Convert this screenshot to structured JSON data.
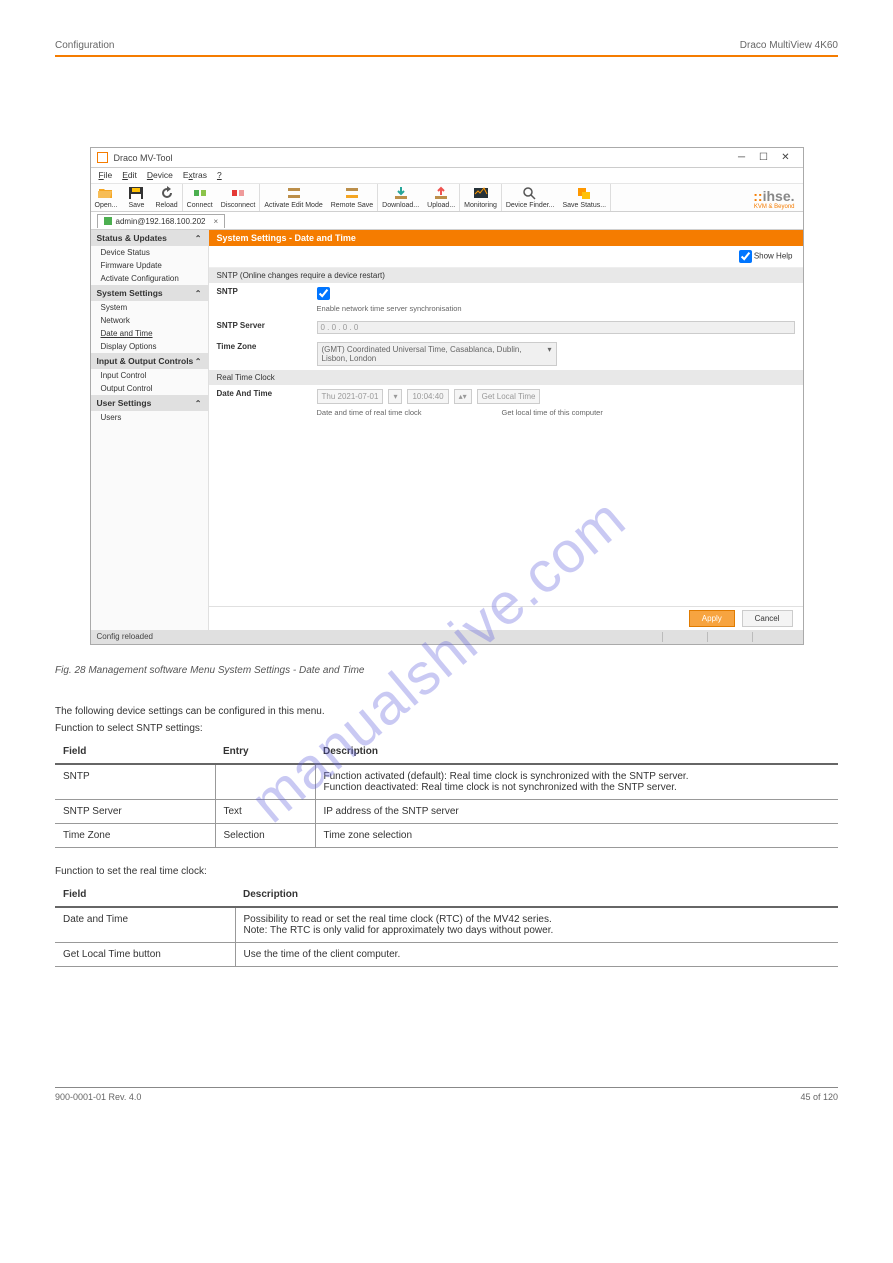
{
  "header": {
    "left": "Configuration",
    "right": "Draco MultiView 4K60"
  },
  "app": {
    "title": "Draco MV-Tool",
    "menus": [
      "File",
      "Edit",
      "Device",
      "Extras",
      "?"
    ],
    "toolbar": {
      "open": "Open...",
      "save": "Save",
      "reload": "Reload",
      "connect": "Connect",
      "disconnect": "Disconnect",
      "activate_edit_mode": "Activate Edit Mode",
      "remote_save": "Remote Save",
      "download": "Download...",
      "upload": "Upload...",
      "monitoring": "Monitoring",
      "device_finder": "Device Finder...",
      "save_status": "Save Status..."
    },
    "logo": "ihse.",
    "logo_sub": "KVM & Beyond",
    "tab": {
      "label": "admin@192.168.100.202"
    },
    "sidebar": {
      "sections": [
        {
          "title": "Status & Updates",
          "items": [
            "Device Status",
            "Firmware Update",
            "Activate Configuration"
          ]
        },
        {
          "title": "System Settings",
          "items": [
            "System",
            "Network",
            "Date and Time",
            "Display Options"
          ],
          "active_index": 2
        },
        {
          "title": "Input & Output Controls",
          "items": [
            "Input Control",
            "Output Control"
          ]
        },
        {
          "title": "User Settings",
          "items": [
            "Users"
          ]
        }
      ]
    },
    "content": {
      "title": "System Settings - Date and Time",
      "show_help": "Show Help",
      "sntp_section": "SNTP (Online changes require a device restart)",
      "sntp_label": "SNTP",
      "sntp_hint": "Enable network time server synchronisation",
      "sntp_server_label": "SNTP Server",
      "sntp_server_val": "0  .  0  .  0  .  0",
      "timezone_label": "Time Zone",
      "timezone_val": "(GMT) Coordinated Universal Time, Casablanca, Dublin, Lisbon, London",
      "rtc_section": "Real Time Clock",
      "datetime_label": "Date And Time",
      "date_val": "Thu    2021-07-01",
      "time_val": "10:04:40",
      "datetime_btn": "Get Local Time",
      "datetime_hint1": "Date and time of real time clock",
      "datetime_hint2": "Get local time of this computer"
    },
    "buttons": {
      "apply": "Apply",
      "cancel": "Cancel"
    },
    "status": "Config reloaded"
  },
  "watermark": "manualshive.com",
  "caption": "Fig. 28 Management software Menu System Settings - Date and Time",
  "body1": "The following device settings can be configured in this menu.",
  "body2": "Function to select SNTP settings:",
  "table1": {
    "head": [
      "Field",
      "Entry",
      "Description"
    ],
    "rows": [
      [
        "SNTP",
        "",
        "Function activated (default): Real time clock is synchronized with the SNTP server.\nFunction deactivated: Real time clock is not synchronized with the SNTP server."
      ],
      [
        "SNTP Server",
        "Text",
        "IP address of the SNTP server"
      ],
      [
        "Time Zone",
        "Selection",
        "Time zone selection"
      ]
    ]
  },
  "body3": "Function to set the real time clock:",
  "table2": {
    "head": [
      "Field",
      "Description"
    ],
    "rows": [
      [
        "Date and Time",
        "Possibility to read or set the real time clock (RTC) of the MV42 series.\nNote: The RTC is only valid for approximately two days without power."
      ],
      [
        "Get Local Time button",
        "Use the time of the client computer."
      ]
    ]
  },
  "footer": {
    "left": "900-0001-01 Rev. 4.0",
    "right": "45 of 120"
  }
}
